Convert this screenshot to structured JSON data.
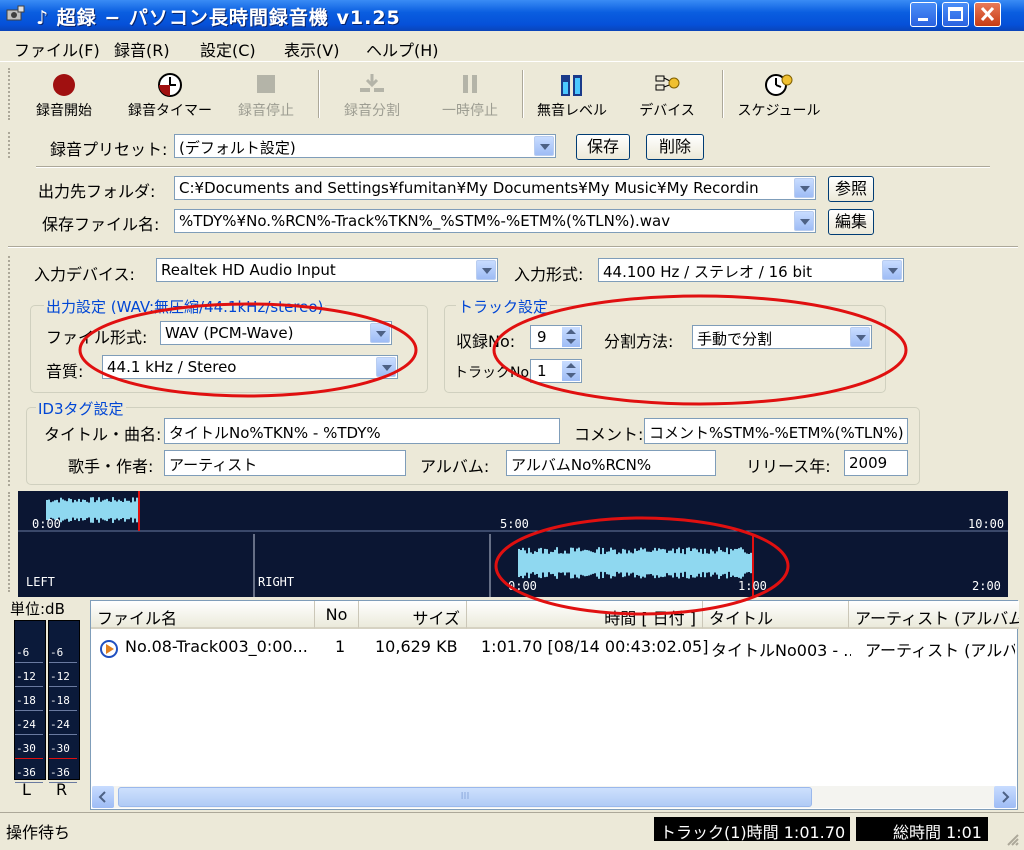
{
  "window": {
    "title": "♪ 超録 − パソコン長時間録音機 v1.25"
  },
  "menu": [
    "ファイル(F)",
    "録音(R)",
    "設定(C)",
    "表示(V)",
    "ヘルプ(H)"
  ],
  "toolbar": {
    "record_start": "録音開始",
    "record_timer": "録音タイマー",
    "record_stop": "録音停止",
    "record_split": "録音分割",
    "pause": "一時停止",
    "silence_level": "無音レベル",
    "device": "デバイス",
    "schedule": "スケジュール"
  },
  "preset": {
    "label": "録音プリセット:",
    "value": "(デフォルト設定)",
    "save_label": "保存",
    "delete_label": "削除"
  },
  "output": {
    "folder_label": "出力先フォルダ:",
    "folder_value": "C:¥Documents and Settings¥fumitan¥My Documents¥My Music¥My Recordin",
    "browse_label": "参照",
    "filename_label": "保存ファイル名:",
    "filename_value": "%TDY%¥No.%RCN%-Track%TKN%_%STM%-%ETM%(%TLN%).wav",
    "edit_label": "編集"
  },
  "input": {
    "device_label": "入力デバイス:",
    "device_value": "Realtek HD Audio Input",
    "format_label": "入力形式:",
    "format_value": "44.100 Hz / ステレオ / 16 bit"
  },
  "output_settings": {
    "title": "出力設定 (WAV:無圧縮/44.1kHz/stereo)",
    "file_format_label": "ファイル形式:",
    "file_format_value": "WAV (PCM-Wave)",
    "quality_label": "音質:",
    "quality_value": "44.1 kHz / Stereo"
  },
  "track_settings": {
    "title": "トラック設定",
    "rec_no_label": "収録No:",
    "rec_no_value": "9",
    "split_label": "分割方法:",
    "split_value": "手動で分割",
    "track_no_label": "トラックNo:",
    "track_no_value": "1"
  },
  "id3": {
    "title": "ID3タグ設定",
    "title_label": "タイトル・曲名:",
    "title_value": "タイトルNo%TKN% - %TDY%",
    "comment_label": "コメント:",
    "comment_value": "コメント%STM%-%ETM%(%TLN%)",
    "artist_label": "歌手・作者:",
    "artist_value": "アーティスト",
    "album_label": "アルバム:",
    "album_value": "アルバムNo%RCN%",
    "year_label": "リリース年:",
    "year_value": "2009"
  },
  "waveform": {
    "top_ticks": [
      "0:00",
      "5:00",
      "10:00"
    ],
    "left_label": "LEFT",
    "right_label": "RIGHT",
    "bottom_ticks": [
      "0:00",
      "1:00",
      "2:00"
    ],
    "overview_fill": 0.12,
    "track_fill": 0.49
  },
  "meter": {
    "unit_label": "単位:dB",
    "ticks": [
      "-6",
      "-12",
      "-18",
      "-24",
      "-30",
      "-36"
    ],
    "left": "L",
    "right": "R"
  },
  "list": {
    "columns": [
      "ファイル名",
      "No",
      "サイズ",
      "時間 [ 日付 ]",
      "タイトル",
      "アーティスト (アルバム)"
    ],
    "rows": [
      {
        "filename": "No.08-Track003_0:00...",
        "no": "1",
        "size": "10,629 KB",
        "time": "1:01.70 [08/14 00:43:02.05]",
        "title": "タイトルNo003 - ...",
        "artist": "アーティスト (アルバム"
      }
    ],
    "scroll_thumb_label": "III"
  },
  "status": {
    "left": "操作待ち",
    "track_time": "トラック(1)時間 1:01.70",
    "total_time": "総時間 1:01"
  },
  "colors": {
    "annotation": "#e01010",
    "titlebar": "#0a5ee0",
    "wave": "#8fd8f0",
    "wave_bg": "#0b1633"
  }
}
